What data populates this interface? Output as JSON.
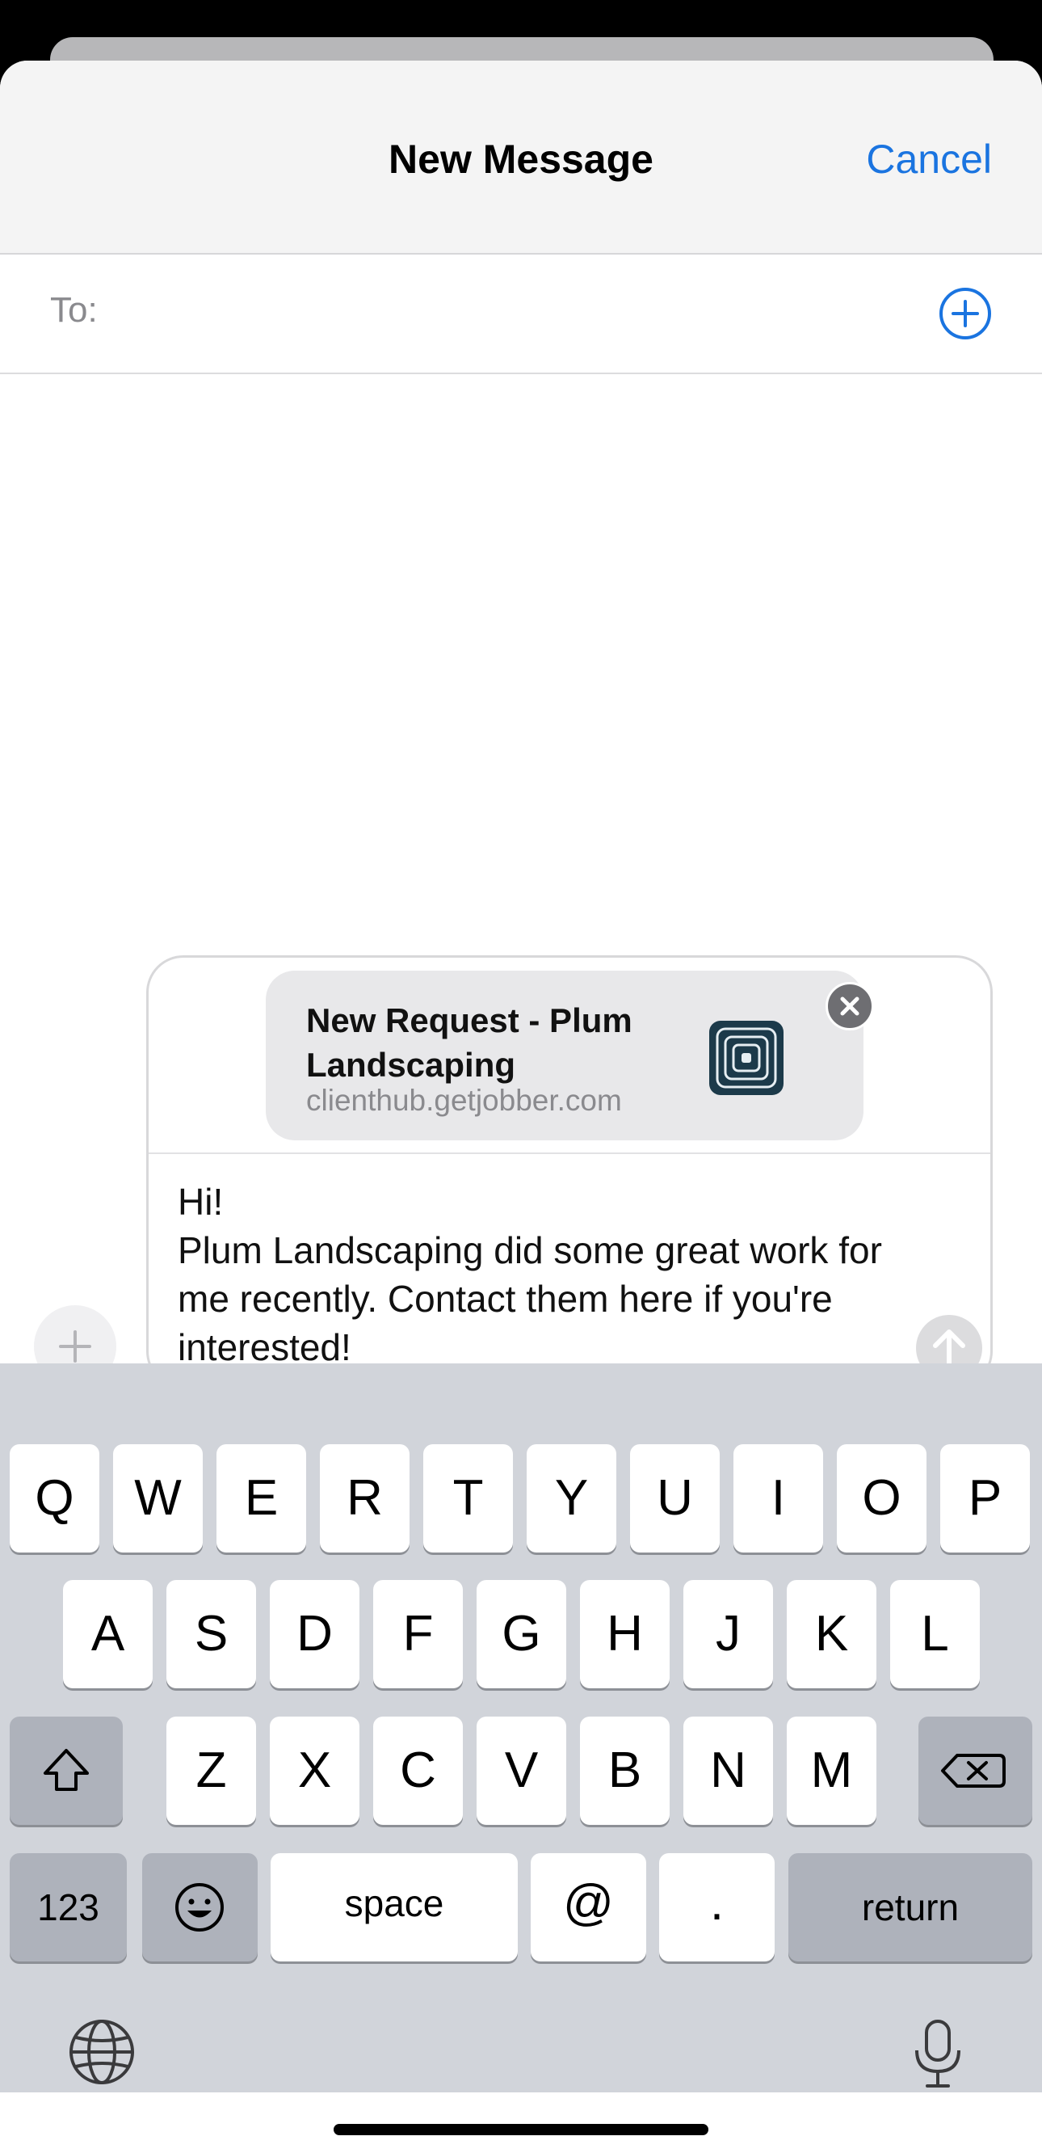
{
  "header": {
    "title": "New Message",
    "cancel_label": "Cancel"
  },
  "recipients": {
    "to_label": "To:",
    "add_icon": "plus-circle-icon"
  },
  "link_preview": {
    "title": "New Request - Plum Landscaping",
    "url": "clienthub.getjobber.com",
    "logo_icon": "jobber-logo-icon",
    "close_icon": "close-icon"
  },
  "message": {
    "body": "Hi!\nPlum Landscaping did some great work for me recently. Contact them here if you're interested!"
  },
  "keyboard": {
    "row1": [
      "Q",
      "W",
      "E",
      "R",
      "T",
      "Y",
      "U",
      "I",
      "O",
      "P"
    ],
    "row2": [
      "A",
      "S",
      "D",
      "F",
      "G",
      "H",
      "J",
      "K",
      "L"
    ],
    "row3": [
      "Z",
      "X",
      "C",
      "V",
      "B",
      "N",
      "M"
    ],
    "numbers_label": "123",
    "space_label": "space",
    "at_label": "@",
    "dot_label": ".",
    "return_label": "return",
    "shift_icon": "shift-icon",
    "delete_icon": "backspace-icon",
    "emoji_icon": "emoji-icon",
    "globe_icon": "globe-icon",
    "mic_icon": "microphone-icon"
  },
  "colors": {
    "accent": "#1a74e0",
    "keyboard_bg": "#d1d4da"
  }
}
